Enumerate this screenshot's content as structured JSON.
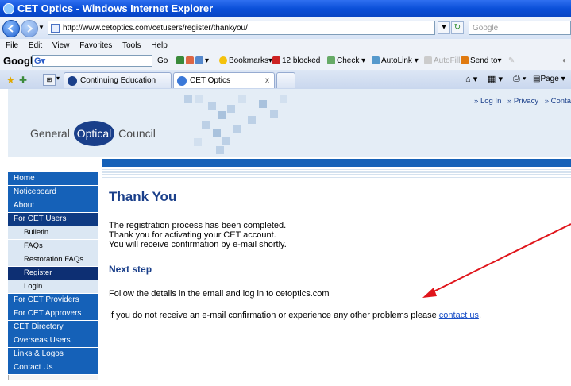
{
  "window": {
    "title": "CET Optics - Windows Internet Explorer"
  },
  "address_bar": {
    "url": "http://www.cetoptics.com/cetusers/register/thankyou/",
    "search_placeholder": "Google"
  },
  "menu": [
    "File",
    "Edit",
    "View",
    "Favorites",
    "Tools",
    "Help"
  ],
  "google_toolbar": {
    "logo": "Google",
    "go": "Go",
    "bookmarks": "Bookmarks",
    "blocked": "12 blocked",
    "check": "Check",
    "autolink": "AutoLink",
    "autofill": "AutoFill",
    "send_to": "Send to"
  },
  "tabs": [
    {
      "label": "Continuing Education and Tr..."
    },
    {
      "label": "CET Optics"
    }
  ],
  "ie_commands": {
    "page": "Page"
  },
  "site": {
    "logo_left": "General",
    "logo_mid": "Optical",
    "logo_right": "Council",
    "top_links": [
      "» Log In",
      "» Privacy",
      "» Conta"
    ]
  },
  "sidebar": {
    "items": [
      {
        "label": "Home",
        "type": "main"
      },
      {
        "label": "Noticeboard",
        "type": "main"
      },
      {
        "label": "About",
        "type": "main"
      },
      {
        "label": "For CET Users",
        "type": "dark"
      },
      {
        "label": "Bulletin",
        "type": "sub"
      },
      {
        "label": "FAQs",
        "type": "sub"
      },
      {
        "label": "Restoration FAQs",
        "type": "sub"
      },
      {
        "label": "Register",
        "type": "active"
      },
      {
        "label": "Login",
        "type": "sub"
      },
      {
        "label": "For CET Providers",
        "type": "main"
      },
      {
        "label": "For CET Approvers",
        "type": "main"
      },
      {
        "label": "CET Directory",
        "type": "main"
      },
      {
        "label": "Overseas Users",
        "type": "main"
      },
      {
        "label": "Links & Logos",
        "type": "main"
      },
      {
        "label": "Contact Us",
        "type": "main"
      }
    ]
  },
  "content": {
    "title": "Thank You",
    "line1": "The registration process has been completed.",
    "line2": "Thank you for activating your CET account.",
    "line3": "You will receive confirmation by e-mail shortly.",
    "next_step": "Next step",
    "follow": "Follow the details in the email and log in to cetoptics.com",
    "problem_prefix": "If you do not receive an e-mail confirmation or experience any other problems please",
    "contact_link": "contact us",
    "problem_suffix": "."
  },
  "colors": {
    "brand_blue": "#1561b8",
    "heading_blue": "#1a3f8a",
    "active_nav": "#0d2f73",
    "annotation_red": "#e0151b"
  }
}
